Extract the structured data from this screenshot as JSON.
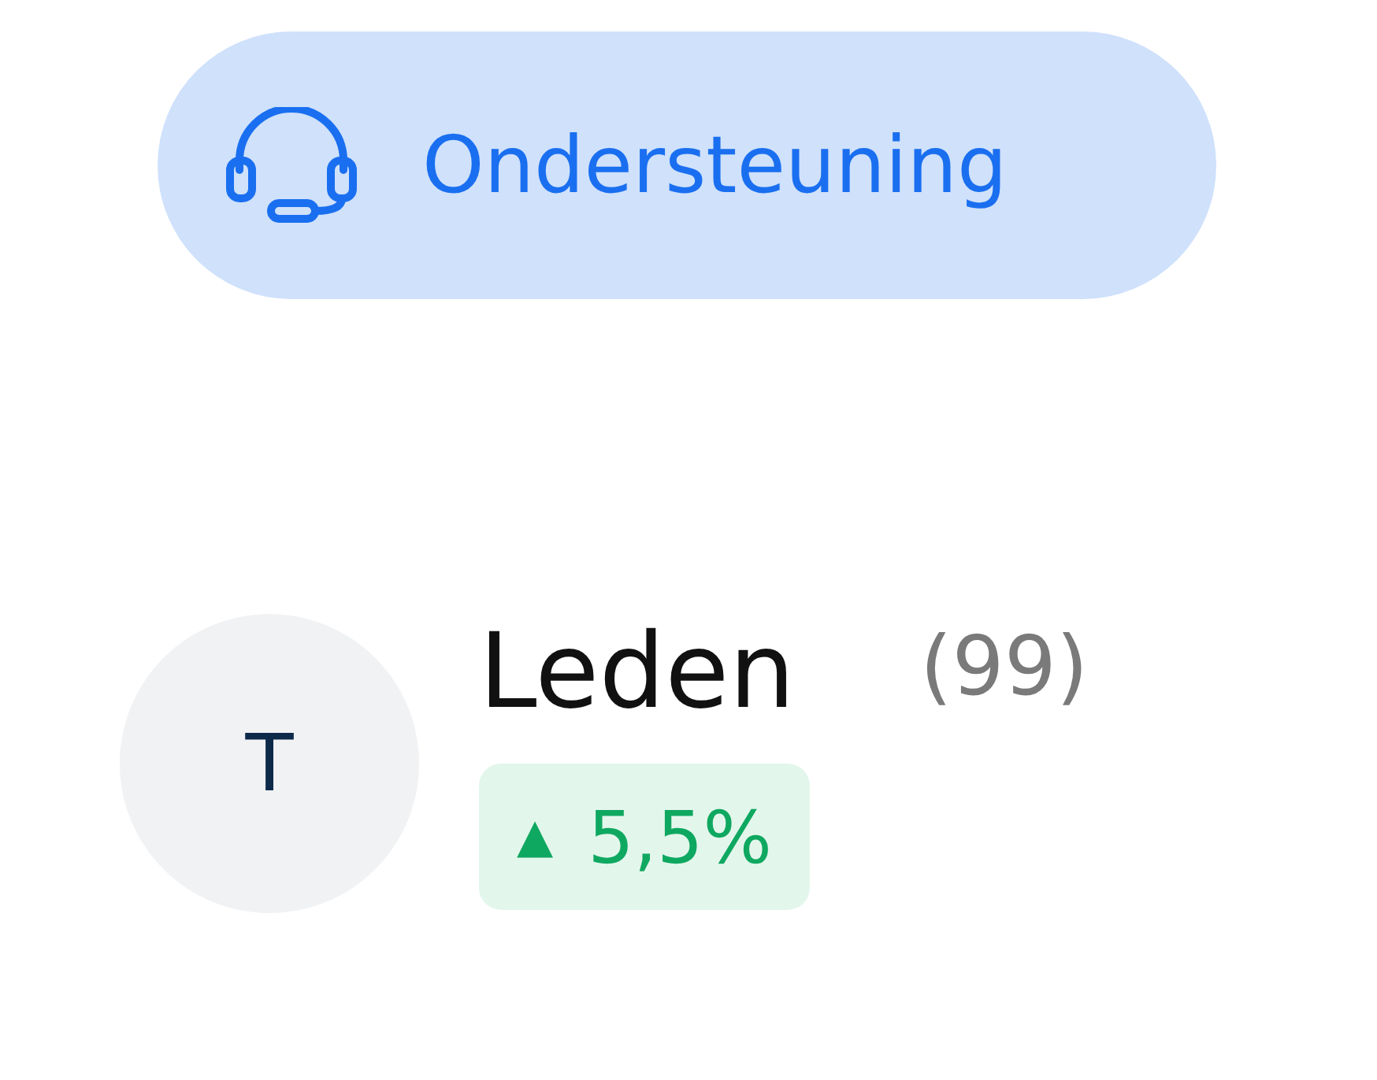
{
  "support_button": {
    "label": "Ondersteuning"
  },
  "member_card": {
    "avatar_initial": "T",
    "title": "Leden",
    "count": "(99)",
    "change": {
      "arrow": "▲",
      "value": "5,5%"
    }
  }
}
